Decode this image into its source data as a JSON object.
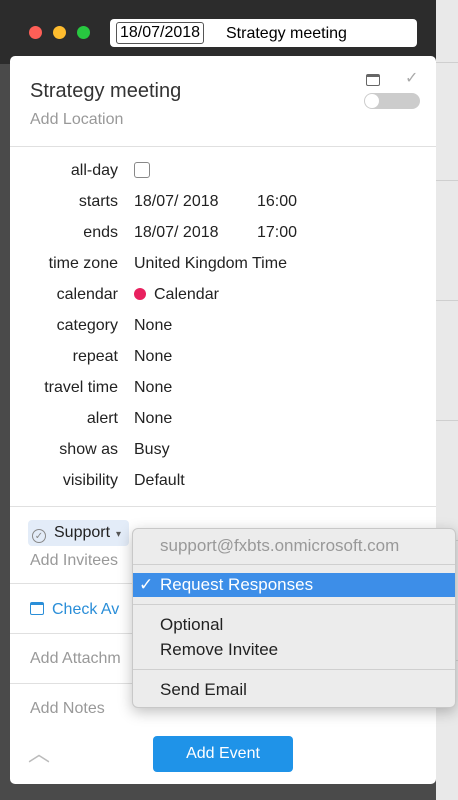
{
  "window": {
    "date_token": "18/07/2018",
    "title": "Strategy meeting"
  },
  "event": {
    "title": "Strategy meeting",
    "location_placeholder": "Add Location",
    "completed_toggle_on": false
  },
  "fields": {
    "allday_label": "all-day",
    "allday_checked": false,
    "starts_label": "starts",
    "starts_date": "18/07/ 2018",
    "starts_time": "16:00",
    "ends_label": "ends",
    "ends_date": "18/07/ 2018",
    "ends_time": "17:00",
    "timezone_label": "time zone",
    "timezone_value": "United Kingdom Time",
    "calendar_label": "calendar",
    "calendar_value": "Calendar",
    "calendar_color": "#e8215f",
    "category_label": "category",
    "category_value": "None",
    "repeat_label": "repeat",
    "repeat_value": "None",
    "travel_label": "travel time",
    "travel_value": "None",
    "alert_label": "alert",
    "alert_value": "None",
    "showas_label": "show as",
    "showas_value": "Busy",
    "visibility_label": "visibility",
    "visibility_value": "Default"
  },
  "invitees": {
    "chip_label": "Support",
    "add_placeholder": "Add Invitees"
  },
  "actions": {
    "check_availability": "Check Av",
    "add_attachment": "Add Attachm",
    "add_notes": "Add Notes",
    "add_event": "Add Event"
  },
  "context_menu": {
    "email": "support@fxbts.onmicrosoft.com",
    "tick": "✓",
    "request_responses": "Request Responses",
    "optional": "Optional",
    "remove_invitee": "Remove Invitee",
    "send_email": "Send Email",
    "highlight_color": "#3d8ee8"
  },
  "icons": {
    "calendar": "calendar-icon",
    "check": "checkmark-icon",
    "collapse": "chevron-up-icon"
  }
}
